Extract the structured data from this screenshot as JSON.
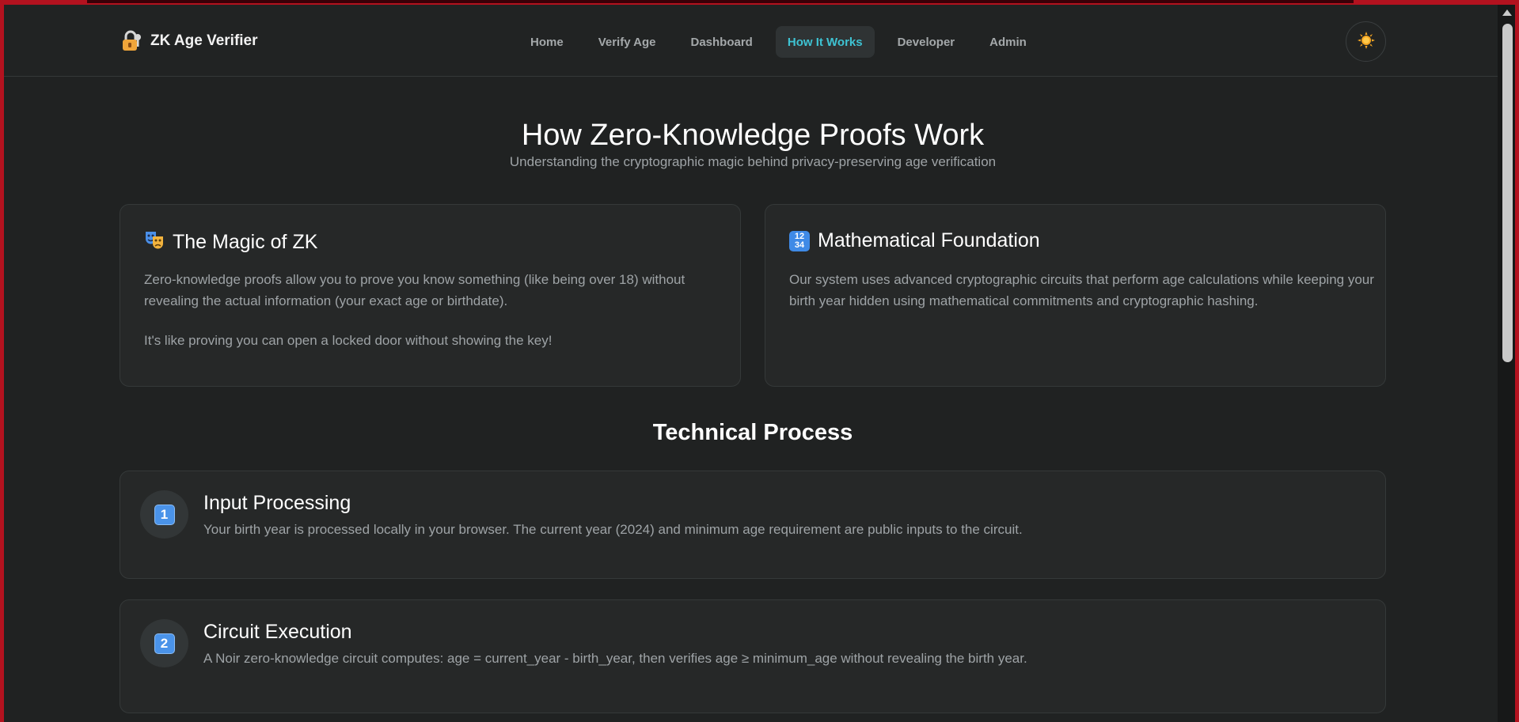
{
  "header": {
    "brand": "ZK Age Verifier",
    "nav": [
      "Home",
      "Verify Age",
      "Dashboard",
      "How It Works",
      "Developer",
      "Admin"
    ],
    "active_nav": "How It Works"
  },
  "hero": {
    "title": "How Zero-Knowledge Proofs Work",
    "subtitle": "Understanding the cryptographic magic behind privacy-preserving age verification"
  },
  "cards": [
    {
      "icon": "theater-masks-icon",
      "title": "The Magic of ZK",
      "paragraphs": [
        "Zero-knowledge proofs allow you to prove you know something (like being over 18) without revealing the actual information (your exact age or birthdate).",
        "It's like proving you can open a locked door without showing the key!"
      ]
    },
    {
      "icon": "numbers-icon",
      "icon_text": "12\n34",
      "title": "Mathematical Foundation",
      "paragraphs": [
        "Our system uses advanced cryptographic circuits that perform age calculations while keeping your birth year hidden using mathematical commitments and cryptographic hashing."
      ]
    }
  ],
  "technical": {
    "title": "Technical Process",
    "steps": [
      {
        "number": "1",
        "title": "Input Processing",
        "text": "Your birth year is processed locally in your browser. The current year (2024) and minimum age requirement are public inputs to the circuit."
      },
      {
        "number": "2",
        "title": "Circuit Execution",
        "text": "A Noir zero-knowledge circuit computes: age = current_year - birth_year, then verifies age ≥ minimum_age without revealing the birth year."
      }
    ]
  },
  "colors": {
    "background": "#202222",
    "card": "#262828",
    "active_nav": "#3ec3d3",
    "frame": "#b3121f"
  }
}
